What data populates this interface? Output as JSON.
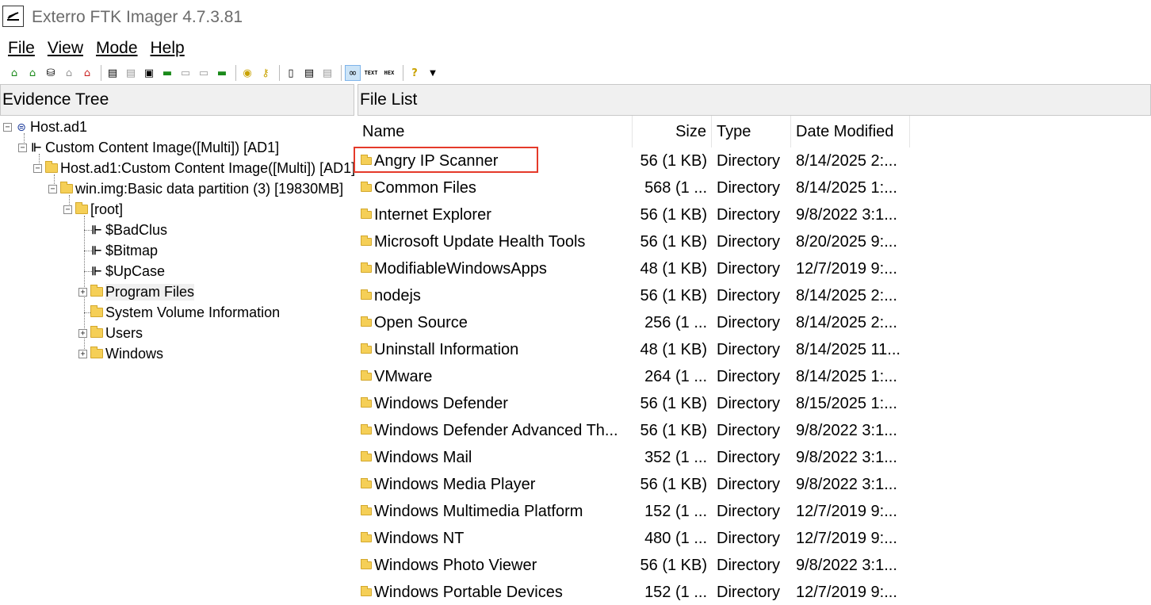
{
  "window": {
    "title": "Exterro FTK Imager 4.7.3.81"
  },
  "menu": [
    {
      "label": "File"
    },
    {
      "label": "View"
    },
    {
      "label": "Mode"
    },
    {
      "label": "Help"
    }
  ],
  "toolbar": {
    "buttons": [
      "add-evidence-icon",
      "add-all-evidence-icon",
      "image-mounting-icon",
      "remove-evidence-icon",
      "remove-all-evidence-icon",
      "create-disk-image-icon",
      "export-disk-image-icon",
      "export-logical-image-icon",
      "add-to-custom-content-icon",
      "create-custom-content-image-icon",
      "decrypt-icon",
      "memory-capture-icon",
      "obtain-protected-files-icon",
      "detect-efs-icon",
      "export-files-icon",
      "export-hash-list-icon",
      "export-directory-listing-icon",
      "auto-view-icon",
      "text-view-icon",
      "hex-view-icon",
      "help-icon",
      "dropdown-icon"
    ],
    "text_label": "TEXT",
    "hex_label": "HEX"
  },
  "evidence_tree": {
    "header": "Evidence Tree",
    "nodes": [
      {
        "label": "Host.ad1"
      },
      {
        "label": "Custom Content Image([Multi]) [AD1]"
      },
      {
        "label": "Host.ad1:Custom Content Image([Multi]) [AD1]"
      },
      {
        "label": "win.img:Basic data partition (3) [19830MB]"
      },
      {
        "label": "[root]"
      },
      {
        "label": "$BadClus"
      },
      {
        "label": "$Bitmap"
      },
      {
        "label": "$UpCase"
      },
      {
        "label": "Program Files"
      },
      {
        "label": "System Volume Information"
      },
      {
        "label": "Users"
      },
      {
        "label": "Windows"
      }
    ]
  },
  "file_list": {
    "header": "File List",
    "columns": {
      "name": "Name",
      "size": "Size",
      "type": "Type",
      "date": "Date Modified"
    },
    "rows": [
      {
        "name": "Angry IP Scanner",
        "size": "56 (1 KB)",
        "type": "Directory",
        "date": "8/14/2025 2:..."
      },
      {
        "name": "Common Files",
        "size": "568 (1 ...",
        "type": "Directory",
        "date": "8/14/2025 1:..."
      },
      {
        "name": "Internet Explorer",
        "size": "56 (1 KB)",
        "type": "Directory",
        "date": "9/8/2022 3:1..."
      },
      {
        "name": "Microsoft Update Health Tools",
        "size": "56 (1 KB)",
        "type": "Directory",
        "date": "8/20/2025 9:..."
      },
      {
        "name": "ModifiableWindowsApps",
        "size": "48 (1 KB)",
        "type": "Directory",
        "date": "12/7/2019 9:..."
      },
      {
        "name": "nodejs",
        "size": "56 (1 KB)",
        "type": "Directory",
        "date": "8/14/2025 2:..."
      },
      {
        "name": "Open Source",
        "size": "256 (1 ...",
        "type": "Directory",
        "date": "8/14/2025 2:..."
      },
      {
        "name": "Uninstall Information",
        "size": "48 (1 KB)",
        "type": "Directory",
        "date": "8/14/2025 11..."
      },
      {
        "name": "VMware",
        "size": "264 (1 ...",
        "type": "Directory",
        "date": "8/14/2025 1:..."
      },
      {
        "name": "Windows Defender",
        "size": "56 (1 KB)",
        "type": "Directory",
        "date": "8/15/2025 1:..."
      },
      {
        "name": "Windows Defender Advanced Th...",
        "size": "56 (1 KB)",
        "type": "Directory",
        "date": "9/8/2022 3:1..."
      },
      {
        "name": "Windows Mail",
        "size": "352 (1 ...",
        "type": "Directory",
        "date": "9/8/2022 3:1..."
      },
      {
        "name": "Windows Media Player",
        "size": "56 (1 KB)",
        "type": "Directory",
        "date": "9/8/2022 3:1..."
      },
      {
        "name": "Windows Multimedia Platform",
        "size": "152 (1 ...",
        "type": "Directory",
        "date": "12/7/2019 9:..."
      },
      {
        "name": "Windows NT",
        "size": "480 (1 ...",
        "type": "Directory",
        "date": "12/7/2019 9:..."
      },
      {
        "name": "Windows Photo Viewer",
        "size": "56 (1 KB)",
        "type": "Directory",
        "date": "9/8/2022 3:1..."
      },
      {
        "name": "Windows Portable Devices",
        "size": "152 (1 ...",
        "type": "Directory",
        "date": "12/7/2019 9:..."
      }
    ]
  },
  "colors": {
    "highlight_border": "#e53a2a",
    "folder": "#f5cf57",
    "title_text": "#6b6b6b"
  }
}
